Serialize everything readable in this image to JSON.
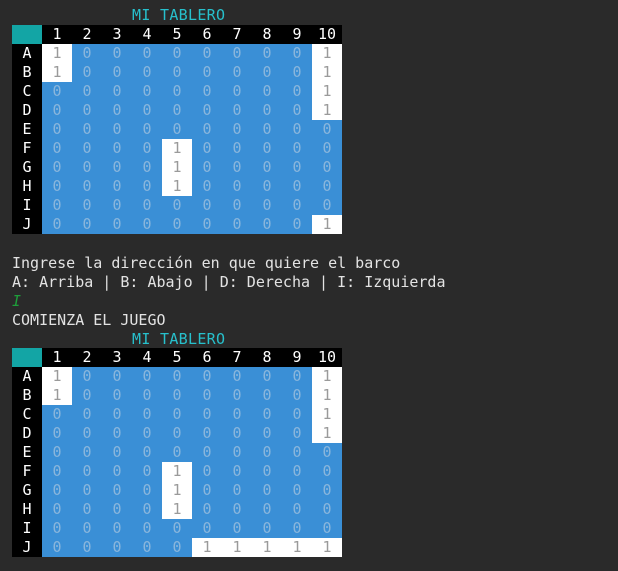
{
  "terminal": {
    "top_partial": "´̃",
    "board_title": "MI TABLERO",
    "prompt_line1": "Ingrese la dirección en que quiere el barco",
    "prompt_line2": "A: Arriba | B: Abajo | D: Derecha | I: Izquierda",
    "user_input": "I",
    "start_message": "COMIENZA EL JUEGO"
  },
  "colors": {
    "background": "#2a2a2a",
    "water": "#3a8fd6",
    "ship": "#ffffff",
    "title": "#27c0cc",
    "corner": "#13a5a5",
    "input": "#1e9e3a"
  },
  "board1": {
    "columns": [
      "1",
      "2",
      "3",
      "4",
      "5",
      "6",
      "7",
      "8",
      "9",
      "10"
    ],
    "rows": [
      {
        "label": "A",
        "cells": [
          1,
          0,
          0,
          0,
          0,
          0,
          0,
          0,
          0,
          1
        ]
      },
      {
        "label": "B",
        "cells": [
          1,
          0,
          0,
          0,
          0,
          0,
          0,
          0,
          0,
          1
        ]
      },
      {
        "label": "C",
        "cells": [
          0,
          0,
          0,
          0,
          0,
          0,
          0,
          0,
          0,
          1
        ]
      },
      {
        "label": "D",
        "cells": [
          0,
          0,
          0,
          0,
          0,
          0,
          0,
          0,
          0,
          1
        ]
      },
      {
        "label": "E",
        "cells": [
          0,
          0,
          0,
          0,
          0,
          0,
          0,
          0,
          0,
          0
        ]
      },
      {
        "label": "F",
        "cells": [
          0,
          0,
          0,
          0,
          1,
          0,
          0,
          0,
          0,
          0
        ]
      },
      {
        "label": "G",
        "cells": [
          0,
          0,
          0,
          0,
          1,
          0,
          0,
          0,
          0,
          0
        ]
      },
      {
        "label": "H",
        "cells": [
          0,
          0,
          0,
          0,
          1,
          0,
          0,
          0,
          0,
          0
        ]
      },
      {
        "label": "I",
        "cells": [
          0,
          0,
          0,
          0,
          0,
          0,
          0,
          0,
          0,
          0
        ]
      },
      {
        "label": "J",
        "cells": [
          0,
          0,
          0,
          0,
          0,
          0,
          0,
          0,
          0,
          1
        ]
      }
    ]
  },
  "board2": {
    "columns": [
      "1",
      "2",
      "3",
      "4",
      "5",
      "6",
      "7",
      "8",
      "9",
      "10"
    ],
    "rows": [
      {
        "label": "A",
        "cells": [
          1,
          0,
          0,
          0,
          0,
          0,
          0,
          0,
          0,
          1
        ]
      },
      {
        "label": "B",
        "cells": [
          1,
          0,
          0,
          0,
          0,
          0,
          0,
          0,
          0,
          1
        ]
      },
      {
        "label": "C",
        "cells": [
          0,
          0,
          0,
          0,
          0,
          0,
          0,
          0,
          0,
          1
        ]
      },
      {
        "label": "D",
        "cells": [
          0,
          0,
          0,
          0,
          0,
          0,
          0,
          0,
          0,
          1
        ]
      },
      {
        "label": "E",
        "cells": [
          0,
          0,
          0,
          0,
          0,
          0,
          0,
          0,
          0,
          0
        ]
      },
      {
        "label": "F",
        "cells": [
          0,
          0,
          0,
          0,
          1,
          0,
          0,
          0,
          0,
          0
        ]
      },
      {
        "label": "G",
        "cells": [
          0,
          0,
          0,
          0,
          1,
          0,
          0,
          0,
          0,
          0
        ]
      },
      {
        "label": "H",
        "cells": [
          0,
          0,
          0,
          0,
          1,
          0,
          0,
          0,
          0,
          0
        ]
      },
      {
        "label": "I",
        "cells": [
          0,
          0,
          0,
          0,
          0,
          0,
          0,
          0,
          0,
          0
        ]
      },
      {
        "label": "J",
        "cells": [
          0,
          0,
          0,
          0,
          0,
          1,
          1,
          1,
          1,
          1
        ]
      }
    ]
  }
}
